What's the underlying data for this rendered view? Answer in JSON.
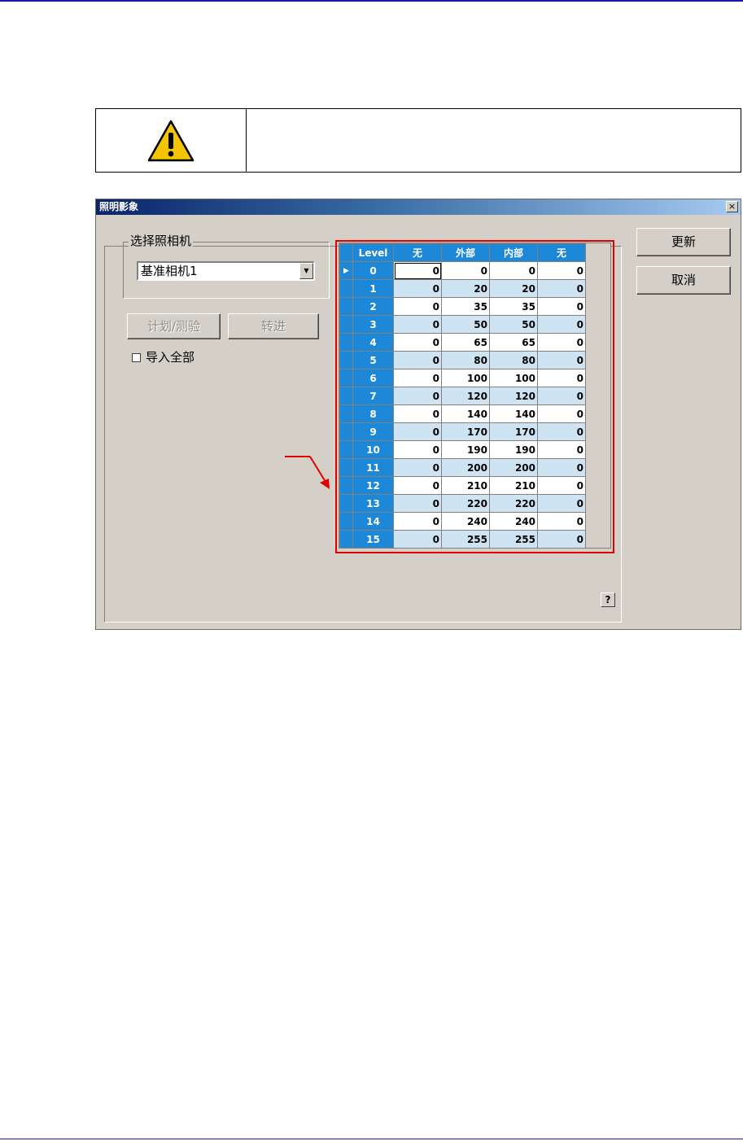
{
  "dialog": {
    "title": "照明影象",
    "close_glyph": "×"
  },
  "camera_group": {
    "label": "选择照相机",
    "selected": "基准相机1",
    "arrow": "▼"
  },
  "buttons": {
    "plan_inspect": "计划/测验",
    "transfer": "转进",
    "update": "更新",
    "cancel": "取消",
    "help": "?"
  },
  "import_all": {
    "label": "导入全部",
    "checked": false
  },
  "grid": {
    "columns": [
      "Level",
      "无",
      "外部",
      "内部",
      "无"
    ],
    "current_row_indicator": "▶",
    "rows": [
      [
        "0",
        "0",
        "0",
        "0",
        "0"
      ],
      [
        "1",
        "0",
        "20",
        "20",
        "0"
      ],
      [
        "2",
        "0",
        "35",
        "35",
        "0"
      ],
      [
        "3",
        "0",
        "50",
        "50",
        "0"
      ],
      [
        "4",
        "0",
        "65",
        "65",
        "0"
      ],
      [
        "5",
        "0",
        "80",
        "80",
        "0"
      ],
      [
        "6",
        "0",
        "100",
        "100",
        "0"
      ],
      [
        "7",
        "0",
        "120",
        "120",
        "0"
      ],
      [
        "8",
        "0",
        "140",
        "140",
        "0"
      ],
      [
        "9",
        "0",
        "170",
        "170",
        "0"
      ],
      [
        "10",
        "0",
        "190",
        "190",
        "0"
      ],
      [
        "11",
        "0",
        "200",
        "200",
        "0"
      ],
      [
        "12",
        "0",
        "210",
        "210",
        "0"
      ],
      [
        "13",
        "0",
        "220",
        "220",
        "0"
      ],
      [
        "14",
        "0",
        "240",
        "240",
        "0"
      ],
      [
        "15",
        "0",
        "255",
        "255",
        "0"
      ]
    ]
  },
  "colors": {
    "grid_header": "#1e88d8",
    "row_alt": "#cfe4f3",
    "highlight": "#e00000",
    "warning_yellow": "#f5c400"
  }
}
